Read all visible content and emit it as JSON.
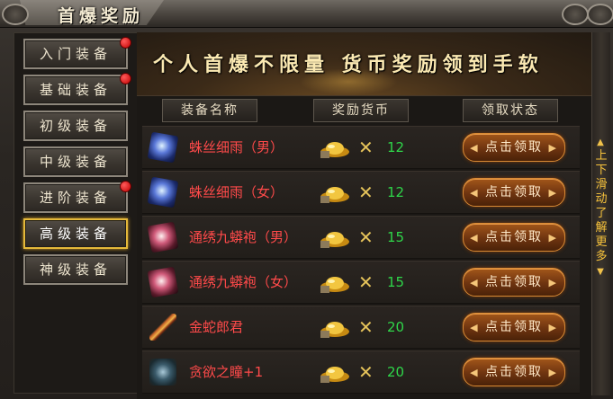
{
  "window": {
    "title": "首爆奖励"
  },
  "sidebar": {
    "items": [
      {
        "label": "入门装备",
        "badge": true,
        "active": false
      },
      {
        "label": "基础装备",
        "badge": true,
        "active": false
      },
      {
        "label": "初级装备",
        "badge": false,
        "active": false
      },
      {
        "label": "中级装备",
        "badge": false,
        "active": false
      },
      {
        "label": "进阶装备",
        "badge": true,
        "active": false
      },
      {
        "label": "高级装备",
        "badge": false,
        "active": true
      },
      {
        "label": "神级装备",
        "badge": false,
        "active": false
      }
    ]
  },
  "banner": {
    "text": "个人首爆不限量 货币奖励领到手软"
  },
  "table": {
    "headers": {
      "name": "装备名称",
      "reward": "奖励货币",
      "status": "领取状态"
    },
    "rows": [
      {
        "icon": "ice-gauntlet-icon",
        "name": "蛛丝细雨（男）",
        "times": "✕",
        "amount": "12",
        "button": "点击领取"
      },
      {
        "icon": "ice-gauntlet-icon",
        "name": "蛛丝细雨（女）",
        "times": "✕",
        "amount": "12",
        "button": "点击领取"
      },
      {
        "icon": "pink-gauntlet-icon",
        "name": "通绣九蟒袍（男）",
        "times": "✕",
        "amount": "15",
        "button": "点击领取"
      },
      {
        "icon": "pink-gauntlet-icon",
        "name": "通绣九蟒袍（女）",
        "times": "✕",
        "amount": "15",
        "button": "点击领取"
      },
      {
        "icon": "blade-icon",
        "name": "金蛇郎君",
        "times": "✕",
        "amount": "20",
        "button": "点击领取"
      },
      {
        "icon": "eye-orb-icon",
        "name": "贪欲之瞳+1",
        "times": "✕",
        "amount": "20",
        "button": "点击领取"
      }
    ]
  },
  "scroll": {
    "hint": "上下滑动了解更多"
  },
  "colors": {
    "accent": "#e5b93a",
    "name_red": "#ff4a4a",
    "amount_green": "#2fd64a"
  }
}
